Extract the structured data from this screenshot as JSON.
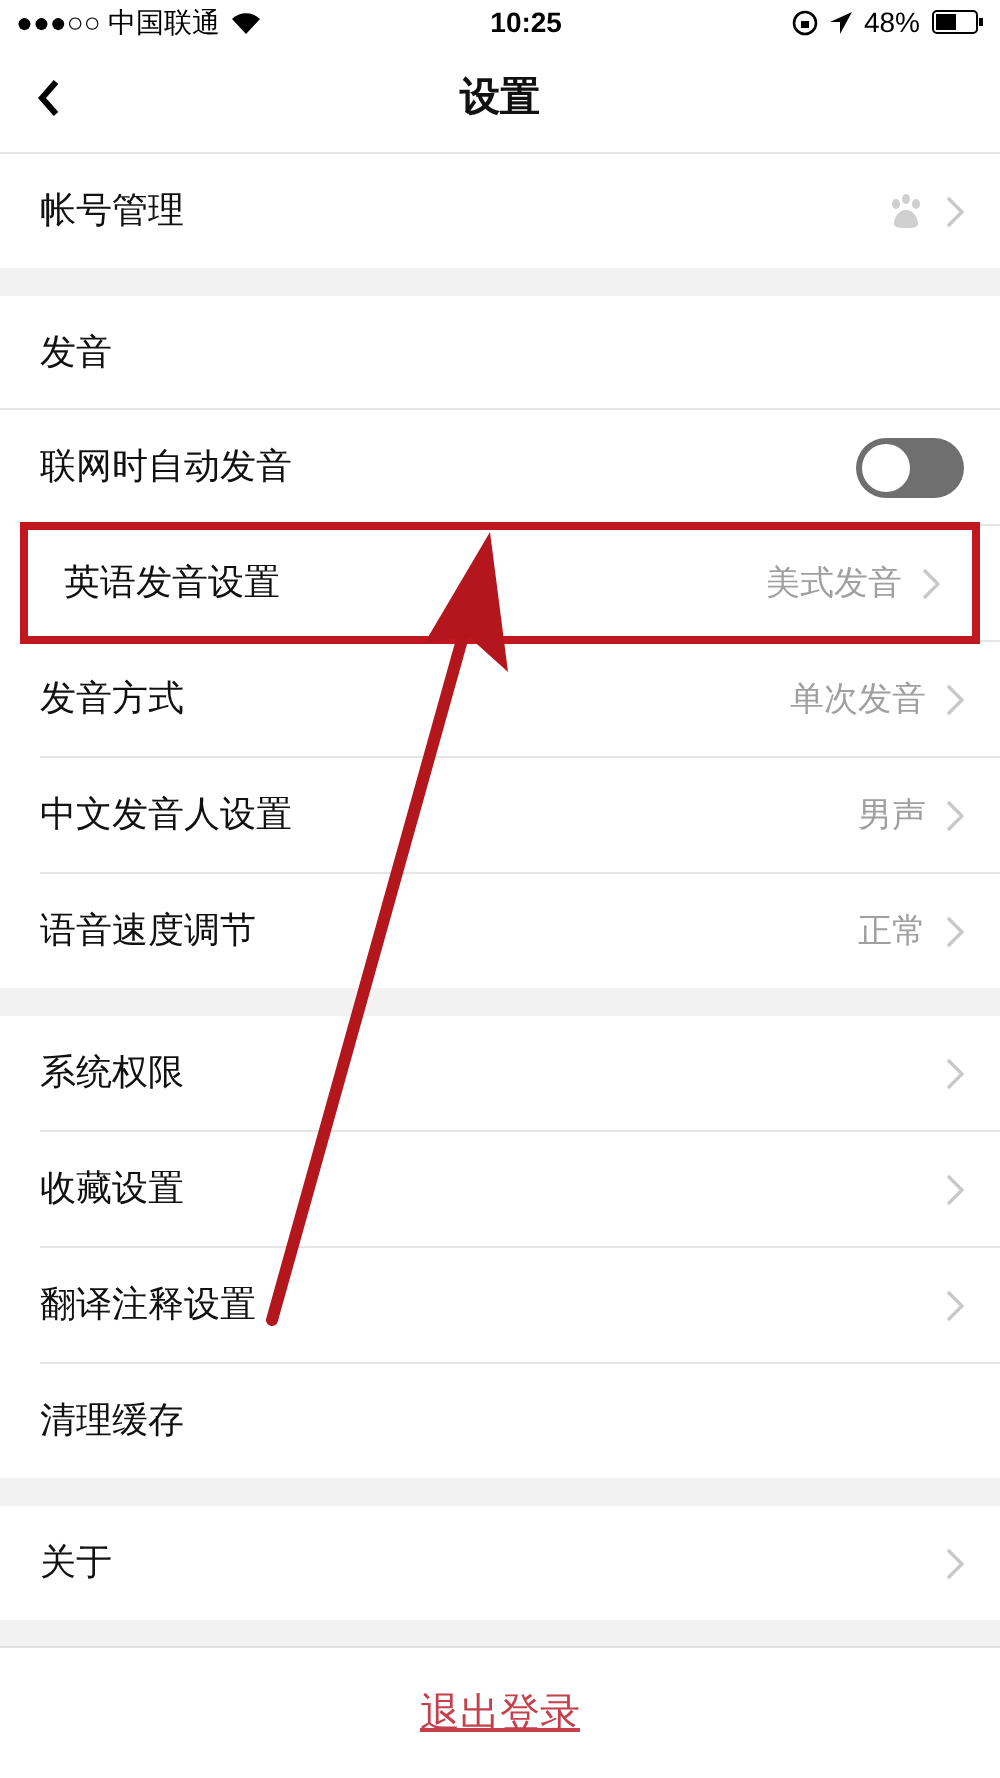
{
  "status_bar": {
    "carrier": "●●●○○ 中国联通",
    "time": "10:25",
    "battery": "48%"
  },
  "nav": {
    "title": "设置"
  },
  "sections": [
    {
      "items": [
        {
          "kind": "account",
          "label": "帐号管理",
          "highlighted": false
        }
      ]
    },
    {
      "header": "发音",
      "items": [
        {
          "kind": "toggle",
          "label": "联网时自动发音",
          "on": false,
          "highlighted": false
        },
        {
          "kind": "link",
          "label": "英语发音设置",
          "value": "美式发音",
          "highlighted": true
        },
        {
          "kind": "link",
          "label": "发音方式",
          "value": "单次发音",
          "highlighted": false
        },
        {
          "kind": "link",
          "label": "中文发音人设置",
          "value": "男声",
          "highlighted": false
        },
        {
          "kind": "link",
          "label": "语音速度调节",
          "value": "正常",
          "highlighted": false
        }
      ]
    },
    {
      "items": [
        {
          "kind": "link",
          "label": "系统权限",
          "highlighted": false
        },
        {
          "kind": "link",
          "label": "收藏设置",
          "highlighted": false
        },
        {
          "kind": "link",
          "label": "翻译注释设置",
          "highlighted": false
        },
        {
          "kind": "plain",
          "label": "清理缓存",
          "highlighted": false
        }
      ]
    },
    {
      "items": [
        {
          "kind": "link",
          "label": "关于",
          "highlighted": false
        }
      ]
    }
  ],
  "logout": "退出登录"
}
